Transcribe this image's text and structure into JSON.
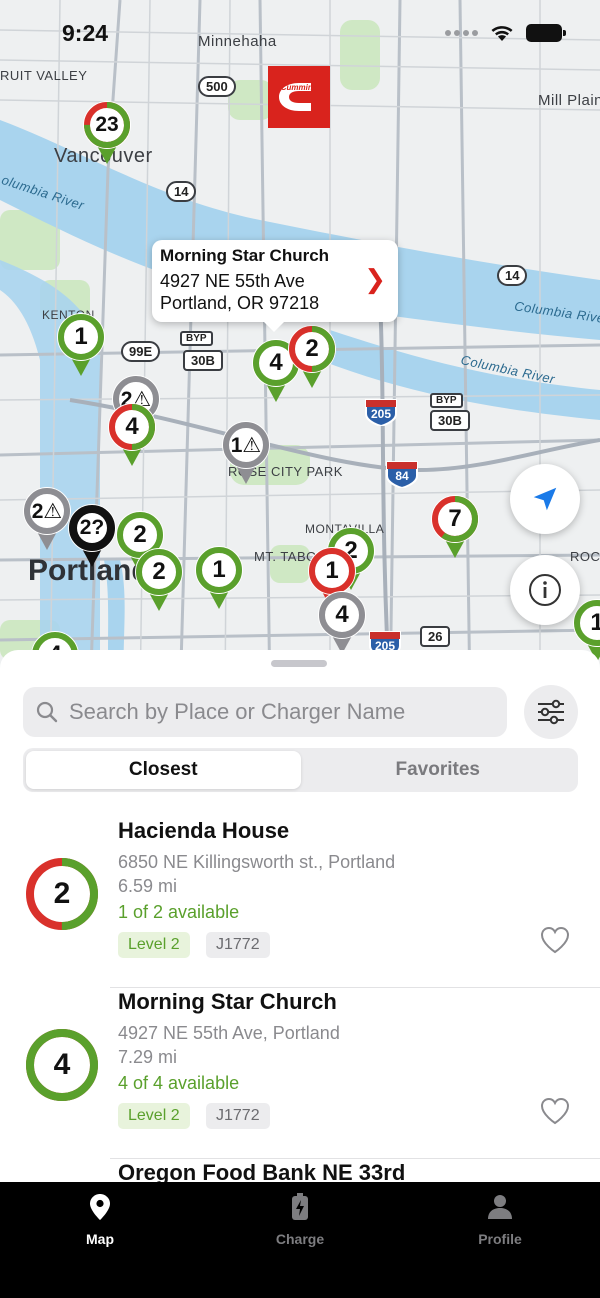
{
  "status_bar": {
    "time": "9:24"
  },
  "map": {
    "labels": {
      "minnehaha": "Minnehaha",
      "fruit_valley": "RUIT VALLEY",
      "mill_plain": "Mill Plain",
      "vancouver": "Vancouver",
      "columbia_river_1": "olumbia River",
      "columbia_river_2": "Columbia River",
      "columbia_river_3": "Columbia River",
      "kenton": "KENTON",
      "rose_city_park": "ROSE CITY PARK",
      "montavilla": "MONTAVILLA",
      "mt_tabor": "MT. TABOR",
      "portland": "Portland",
      "roc": "ROC"
    },
    "shields": {
      "r500": "500",
      "r14a": "14",
      "r14b": "14",
      "r99e": "99E",
      "r30b_a": "30B",
      "r30b_b": "30B",
      "byp": "BYP",
      "i205a": "205",
      "i205b": "205",
      "i84": "84",
      "r26": "26"
    },
    "logo": "Cummins",
    "pins": [
      {
        "label": "23"
      },
      {
        "label": "1"
      },
      {
        "label": "4"
      },
      {
        "label": "2"
      },
      {
        "label": "2⚠"
      },
      {
        "label": "4"
      },
      {
        "label": "1⚠"
      },
      {
        "label": "7"
      },
      {
        "label": "2⚠"
      },
      {
        "label": "2?"
      },
      {
        "label": "2"
      },
      {
        "label": "2"
      },
      {
        "label": "1"
      },
      {
        "label": "2"
      },
      {
        "label": "1"
      },
      {
        "label": "4"
      },
      {
        "label": "1"
      },
      {
        "label": "4"
      }
    ],
    "callout": {
      "title": "Morning Star Church",
      "line1": "4927 NE 55th Ave",
      "line2": "Portland, OR 97218",
      "chevron": "❯"
    }
  },
  "sheet": {
    "search_placeholder": "Search by Place or Charger Name",
    "segments": {
      "closest": "Closest",
      "favorites": "Favorites"
    },
    "items": [
      {
        "count": "2",
        "name": "Hacienda House",
        "address": "6850 NE Killingsworth st., Portland",
        "distance": "6.59 mi",
        "availability": "1 of 2 available",
        "available_fraction": 0.5,
        "level": "Level 2",
        "plug": "J1772"
      },
      {
        "count": "4",
        "name": "Morning Star Church",
        "address": "4927 NE 55th Ave, Portland",
        "distance": "7.29 mi",
        "availability": "4 of 4 available",
        "available_fraction": 1.0,
        "level": "Level 2",
        "plug": "J1772"
      },
      {
        "name": "Oregon Food Bank NE 33rd"
      }
    ]
  },
  "tabbar": {
    "map": "Map",
    "charge": "Charge",
    "profile": "Profile"
  },
  "colors": {
    "available": "#5aa02c",
    "busy": "#d9312b",
    "offline": "#8e8e93",
    "brand": "#d9231d"
  }
}
